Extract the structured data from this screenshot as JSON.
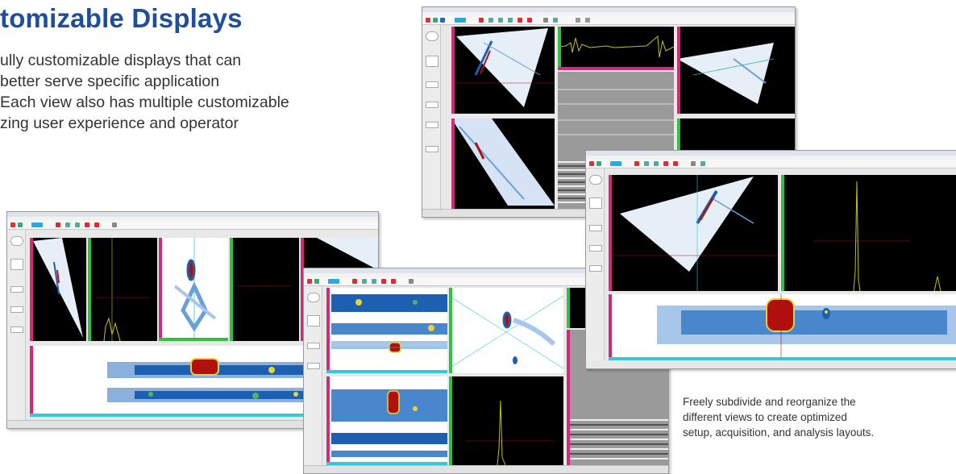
{
  "heading": "tomizable Displays",
  "intro_lines": [
    "ully customizable displays that can",
    "better serve specific application",
    "Each view also has multiple customizable",
    "zing user experience and operator"
  ],
  "caption_lines": [
    "Freely subdivide and reorganize the",
    "different views to create optimized",
    "setup, acquisition, and analysis layouts."
  ],
  "colors": {
    "heading": "#1f4e9c",
    "body_text": "#333333",
    "pane_background": "#000000",
    "scan_blue": "#1d5fb0",
    "indication_red": "#b01010",
    "edge_magenta": "#d4287a",
    "edge_green": "#32c040",
    "edge_cyan": "#35c8d8"
  },
  "screens": [
    {
      "name": "screenshot-top-right",
      "layout": "three-sector-plus-ascan-bscan"
    },
    {
      "name": "screenshot-bottom-left",
      "layout": "four-views-plus-cscan"
    },
    {
      "name": "screenshot-bottom-middle",
      "layout": "two-cscans-plus-sector-ascan"
    },
    {
      "name": "screenshot-right-front",
      "layout": "sector-ascan-plus-cscan"
    }
  ]
}
